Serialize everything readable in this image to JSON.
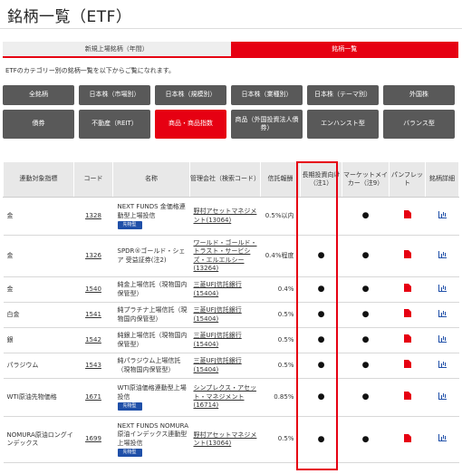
{
  "page": {
    "title": "銘柄一覧（ETF）"
  },
  "tabs": [
    {
      "label": "新規上場銘柄（年間）",
      "active": false
    },
    {
      "label": "銘柄一覧",
      "active": true
    }
  ],
  "intro": "ETFのカテゴリー別の銘柄一覧を以下からご覧になれます。",
  "categories_row1": [
    {
      "label": "全銘柄"
    },
    {
      "label": "日本株（市場別）"
    },
    {
      "label": "日本株（規模別）"
    },
    {
      "label": "日本株（業種別）"
    },
    {
      "label": "日本株（テーマ別）"
    },
    {
      "label": "外国株"
    }
  ],
  "categories_row2": [
    {
      "label": "債券"
    },
    {
      "label": "不動産（REIT）"
    },
    {
      "label": "商品・商品指数",
      "active": true
    },
    {
      "label": "商品（外国投資法人債券）"
    },
    {
      "label": "エンハンスト型"
    },
    {
      "label": "バランス型"
    }
  ],
  "table": {
    "headers": [
      "連動対象指標",
      "コード",
      "名称",
      "管理会社（検索コード）",
      "信託報酬",
      "長期投資向け（注1）",
      "マーケットメイカー（注9）",
      "パンフレット",
      "銘柄詳細"
    ],
    "badge_label": "先物型",
    "dot": "●",
    "rows": [
      {
        "index": "金",
        "code": "1328",
        "name": "NEXT FUNDS 金価格連動型上場投信",
        "badge": true,
        "manager": "野村アセットマネジメント(13064)",
        "fee": "0.5%以内",
        "long_term": false,
        "market_maker": true
      },
      {
        "index": "金",
        "code": "1326",
        "name": "SPDR®ゴールド・シェア 受益証券(注2)",
        "badge": false,
        "manager": "ワールド・ゴールド・トラスト・サービシズ・エルエルシー(13264)",
        "fee": "0.4%程度",
        "long_term": true,
        "market_maker": true
      },
      {
        "index": "金",
        "code": "1540",
        "name": "純金上場信託（現物国内保管型）",
        "badge": false,
        "manager": "三菱UFJ信託銀行(15404)",
        "fee": "0.4%",
        "long_term": true,
        "market_maker": true
      },
      {
        "index": "白金",
        "code": "1541",
        "name": "純プラチナ上場信託（現物国内保管型）",
        "badge": false,
        "manager": "三菱UFJ信託銀行(15404)",
        "fee": "0.5%",
        "long_term": true,
        "market_maker": true
      },
      {
        "index": "銀",
        "code": "1542",
        "name": "純銀上場信託（現物国内保管型）",
        "badge": false,
        "manager": "三菱UFJ信託銀行(15404)",
        "fee": "0.5%",
        "long_term": true,
        "market_maker": true
      },
      {
        "index": "パラジウム",
        "code": "1543",
        "name": "純パラジウム上場信託（現物国内保管型）",
        "badge": false,
        "manager": "三菱UFJ信託銀行(15404)",
        "fee": "0.5%",
        "long_term": true,
        "market_maker": true
      },
      {
        "index": "WTI原油先物価格",
        "code": "1671",
        "name": "WTI原油価格連動型上場投信",
        "badge": true,
        "manager": "シンプレクス・アセット・マネジメント(16714)",
        "fee": "0.85%",
        "long_term": true,
        "market_maker": true
      },
      {
        "index": "NOMURA原油ロングインデックス",
        "code": "1699",
        "name": "NEXT FUNDS NOMURA原油インデックス連動型上場投信",
        "badge": true,
        "manager": "野村アセットマネジメント(13064)",
        "fee": "0.5%",
        "long_term": true,
        "market_maker": true
      }
    ]
  }
}
